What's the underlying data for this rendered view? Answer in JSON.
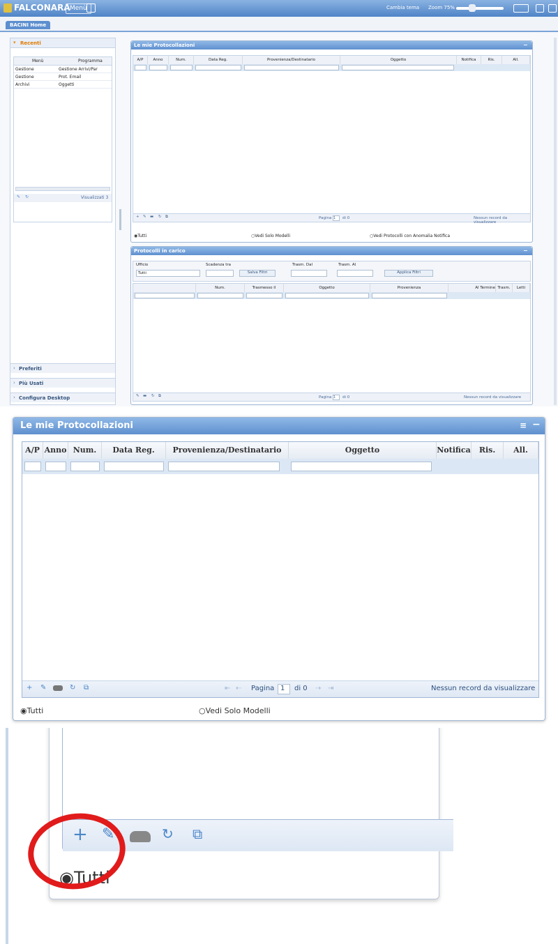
{
  "topbar": {
    "logo": "FALCONARA",
    "menu_button": "Menù",
    "center_label": "Cambia tema",
    "zoom_label": "Zoom 75%"
  },
  "tabs": [
    "BACINI Home"
  ],
  "left": {
    "recent_header": "Recenti",
    "col_menu": "Menù",
    "col_program": "Programma",
    "rows": [
      {
        "menu": "Gestione",
        "program": "Gestione Arrivi/Par"
      },
      {
        "menu": "Gestione",
        "program": "Prot. Email"
      },
      {
        "menu": "Archivi",
        "program": "Oggetti"
      }
    ],
    "visualizzati": "Visualizzati 3",
    "preferiti": "Preferiti",
    "piu_usati": "Più Usati",
    "configura": "Configura Desktop"
  },
  "protocollazioni": {
    "title": "Le mie Protocollazioni",
    "columns": [
      "A/P",
      "Anno",
      "Num.",
      "Data Reg.",
      "Provenienza/Destinatario",
      "Oggetto",
      "Notifica",
      "Ris.",
      "All."
    ],
    "pagina_label": "Pagina",
    "page_value": "1",
    "of_label": "di 0",
    "empty": "Nessun record da visualizzare",
    "radio_tutti": "Tutti",
    "radio_modelli": "Vedi Solo Modelli",
    "radio_anomalia": "Vedi Protocolli con Anomalia Notifica"
  },
  "carico": {
    "title": "Protocolli in carico",
    "ufficio_label": "Ufficio",
    "ufficio_value": "Tutti",
    "scadenza_label": "Scadenza tra",
    "salva_filtri": "Salva Filtri",
    "trasm_dal": "Trasm. Dal",
    "trasm_al": "Trasm. Al",
    "applica_filtri": "Applica Filtri",
    "columns": [
      "Num.",
      "Trasmesso il",
      "Oggetto",
      "Provenienza",
      "Al Termine",
      "Trasm.",
      "Letti"
    ],
    "pagina_label": "Pagina",
    "page_value": "1",
    "of_label": "di 0",
    "empty": "Nessun record da visualizzare"
  },
  "zoom3": {
    "radio_tutti": "Tutti"
  },
  "colors": {
    "header_blue": "#6a9cd8",
    "annotation_red": "#e11b1b",
    "border": "#9fb7d6"
  }
}
